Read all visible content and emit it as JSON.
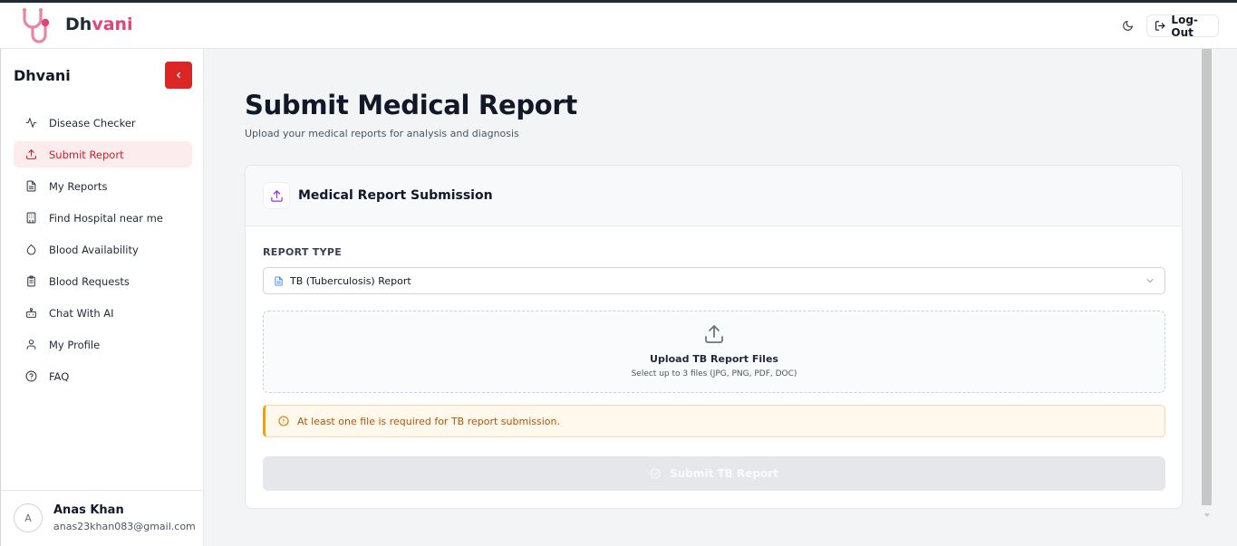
{
  "app": {
    "brand_part1": "Dh",
    "brand_part2": "vani",
    "accent_color": "#dc2626",
    "brand_pink": "#e0447a"
  },
  "header": {
    "theme_icon": "moon-icon",
    "logout_label": "Log-Out",
    "logout_icon": "log-out-icon"
  },
  "sidebar": {
    "title": "Dhvani",
    "collapse_icon": "chevron-left-icon",
    "items": [
      {
        "label": "Disease Checker",
        "icon": "activity-icon",
        "active": false
      },
      {
        "label": "Submit Report",
        "icon": "upload-icon",
        "active": true
      },
      {
        "label": "My Reports",
        "icon": "file-text-icon",
        "active": false
      },
      {
        "label": "Find Hospital near me",
        "icon": "building-icon",
        "active": false
      },
      {
        "label": "Blood Availability",
        "icon": "droplet-icon",
        "active": false
      },
      {
        "label": "Blood Requests",
        "icon": "clipboard-icon",
        "active": false
      },
      {
        "label": "Chat With AI",
        "icon": "bot-icon",
        "active": false
      },
      {
        "label": "My Profile",
        "icon": "user-icon",
        "active": false
      },
      {
        "label": "FAQ",
        "icon": "help-circle-icon",
        "active": false
      }
    ],
    "user": {
      "initial": "A",
      "name": "Anas Khan",
      "email": "anas23khan083@gmail.com"
    }
  },
  "main": {
    "title": "Submit Medical Report",
    "subtitle": "Upload your medical reports for analysis and diagnosis",
    "card": {
      "title": "Medical Report Submission",
      "report_type_label": "REPORT TYPE",
      "report_type_value": "TB (Tuberculosis) Report",
      "upload_title": "Upload TB Report Files",
      "upload_hint": "Select up to 3 files (JPG, PNG, PDF, DOC)",
      "alert_text": "At least one file is required for TB report submission.",
      "submit_label": "Submit TB Report"
    }
  }
}
